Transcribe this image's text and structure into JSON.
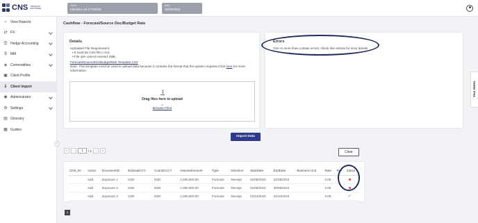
{
  "brand": {
    "name": "CNS",
    "tagline_1": "TREASURY",
    "tagline_2": "SOFTWARE"
  },
  "context": {
    "client": {
      "label": "Client",
      "value": "Idemitsu US CTS0040"
    },
    "date": {
      "label": "Date",
      "value": "30/09/2024"
    }
  },
  "sidebar": {
    "items": [
      {
        "label": "View Reports",
        "icon": "chart-line-icon",
        "chevron": false
      },
      {
        "label": "FX",
        "icon": "exchange-icon",
        "chevron": true
      },
      {
        "label": "Hedge Accounting",
        "icon": "ledger-icon",
        "chevron": true
      },
      {
        "label": "MM",
        "icon": "dollar-icon",
        "chevron": true
      },
      {
        "label": "Commodities",
        "icon": "commodity-icon",
        "chevron": true
      },
      {
        "label": "Client Profile",
        "icon": "profile-icon",
        "chevron": false
      },
      {
        "label": "Client Import",
        "icon": "import-icon",
        "chevron": false,
        "active": true
      },
      {
        "label": "Administrator",
        "icon": "admin-icon",
        "chevron": true
      },
      {
        "label": "Settings",
        "icon": "gear-icon",
        "chevron": true
      },
      {
        "label": "Glossary",
        "icon": "book-icon",
        "chevron": false
      },
      {
        "label": "Guides",
        "icon": "guide-icon",
        "chevron": false
      }
    ]
  },
  "page": {
    "title": "Cashflow - Forecast/Source Doc/Budget Rate"
  },
  "details": {
    "title": "Details",
    "requirements_heading": "Uploaded File Requirement:",
    "req_1": "• It must be CSV file (.csv).",
    "req_2": "• File size cannot exceed 1MB.",
    "template_link": "Forecast/SourceDoc/BudgetRate Template.CSV",
    "note_prefix": "Note: This template must be used to upload data because it contains the format that the system requires.Click ",
    "note_link": "here",
    "note_suffix": " for more",
    "note_line2": "information.",
    "dropzone": {
      "main": "Drag files here to upload",
      "or": "or",
      "browse": "Browse Files"
    }
  },
  "errors": {
    "title": "Errors",
    "message": "One or more lines contain errors, check line entries for error details"
  },
  "import_button": "Import Data",
  "pager": {
    "first": "«",
    "prev": "‹",
    "current": "1",
    "total": "/ 1",
    "next": "›",
    "last": "»"
  },
  "clear_button": "Clear",
  "table": {
    "columns": [
      "CNS_ID",
      "Action",
      "DocumentID",
      "NotionalCCY",
      "CounterCCY",
      "NotionalAmount",
      "Type",
      "Direction",
      "StartDate",
      "EndDate",
      "Business Unit",
      "Rate",
      "Ref",
      "Status"
    ],
    "rows": [
      {
        "cns_id": "",
        "action": "Add",
        "document_id": "Exposure 1",
        "notional_ccy": "USD",
        "counter_ccy": "NZD",
        "notional_amount": "1,000,000.00",
        "type": "Forecast",
        "direction": "Receipt",
        "start_date": "01/08/2024",
        "end_date": "31/08/2024",
        "business_unit": "",
        "rate": "0.00",
        "ref": "",
        "status": "error"
      },
      {
        "cns_id": "",
        "action": "Add",
        "document_id": "Exposure 2",
        "notional_ccy": "USD",
        "counter_ccy": "NZD",
        "notional_amount": "1,000,000.00",
        "type": "Forecast",
        "direction": "Receipt",
        "start_date": "01/09/2024",
        "end_date": "30/09/2024",
        "business_unit": "",
        "rate": "0.00",
        "ref": "",
        "status": "error"
      },
      {
        "cns_id": "",
        "action": "Add",
        "document_id": "Exposure 3",
        "notional_ccy": "USD",
        "counter_ccy": "NZD",
        "notional_amount": "1,000,000.00",
        "type": "Forecast",
        "direction": "Receipt",
        "start_date": "01/10/2024",
        "end_date": "31/10/2024",
        "business_unit": "",
        "rate": "0.00",
        "ref": "",
        "status": "ok"
      }
    ]
  },
  "page_badge": "1",
  "side_tab": "Your Notes",
  "colors": {
    "primary": "#2e3a8c",
    "error": "#e0413a",
    "ok": "#2f9e44",
    "annotation": "#1f2a5a"
  }
}
